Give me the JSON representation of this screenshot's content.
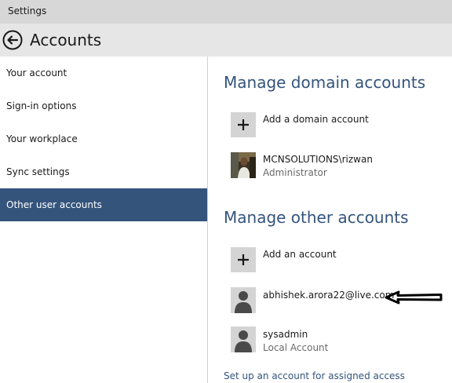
{
  "window": {
    "title": "Settings"
  },
  "header": {
    "title": "Accounts"
  },
  "sidebar": {
    "items": [
      {
        "label": "Your account"
      },
      {
        "label": "Sign-in options"
      },
      {
        "label": "Your workplace"
      },
      {
        "label": "Sync settings"
      },
      {
        "label": "Other user accounts",
        "active": true
      }
    ]
  },
  "domain_section": {
    "title": "Manage domain accounts",
    "add_label": "Add a domain account",
    "accounts": [
      {
        "name": "MCNSOLUTIONS\\rizwan",
        "role": "Administrator"
      }
    ]
  },
  "other_section": {
    "title": "Manage other accounts",
    "add_label": "Add an account",
    "accounts": [
      {
        "name": "abhishek.arora22@live.com",
        "role": ""
      },
      {
        "name": "sysadmin",
        "role": "Local Account"
      }
    ]
  },
  "assigned_access_link": "Set up an account for assigned access",
  "colors": {
    "accent": "#34547c",
    "tile": "#d4d4d4",
    "header": "#e6e6e6",
    "titlebar": "#d7d7d7"
  }
}
